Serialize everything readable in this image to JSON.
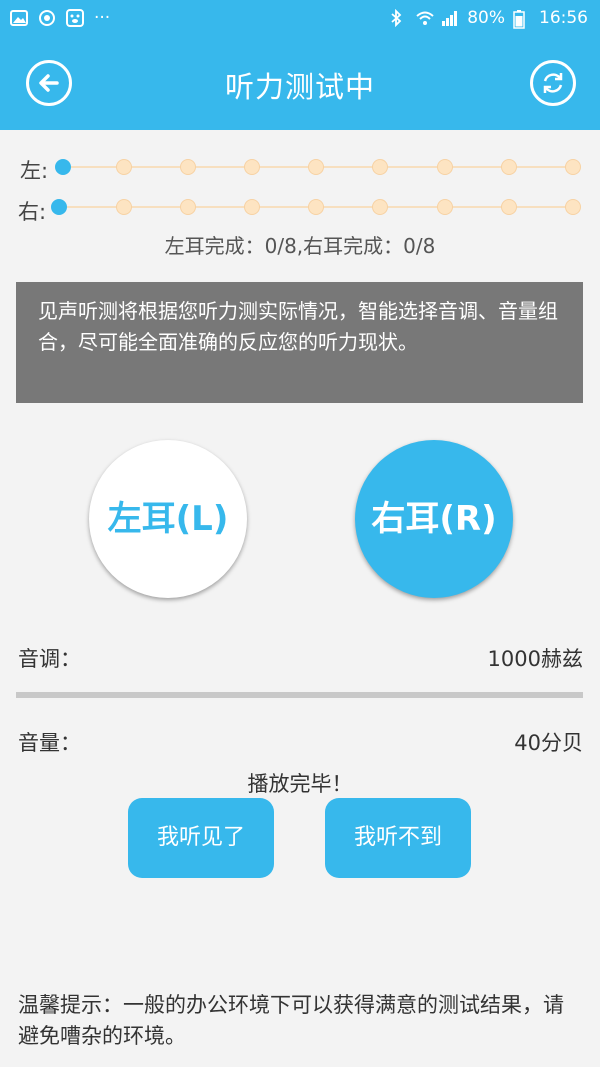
{
  "status_bar": {
    "battery": "80%",
    "time": "16:56",
    "dots": "···"
  },
  "header": {
    "title": "听力测试中"
  },
  "progress": {
    "left_label": "左:",
    "right_label": "右:",
    "summary": "左耳完成：0/8,右耳完成：0/8",
    "left_done": 0,
    "right_done": 0,
    "total": 8
  },
  "info": "见声听测将根据您听力测实际情况，智能选择音调、音量组合，尽可能全面准确的反应您的听力现状。",
  "ears": {
    "left_label": "左耳(L)",
    "right_label": "右耳(R)"
  },
  "tone": {
    "label": "音调：",
    "value": "1000赫兹"
  },
  "volume": {
    "label": "音量：",
    "value": "40分贝"
  },
  "play_status": "播放完毕！",
  "buttons": {
    "heard": "我听见了",
    "not_heard": "我听不到"
  },
  "tip": "温馨提示：一般的办公环境下可以获得满意的测试结果，请避免嘈杂的环境。",
  "colors": {
    "accent": "#37b8ec",
    "info_bg": "#787878",
    "dot_idle": "#fde4c2"
  }
}
